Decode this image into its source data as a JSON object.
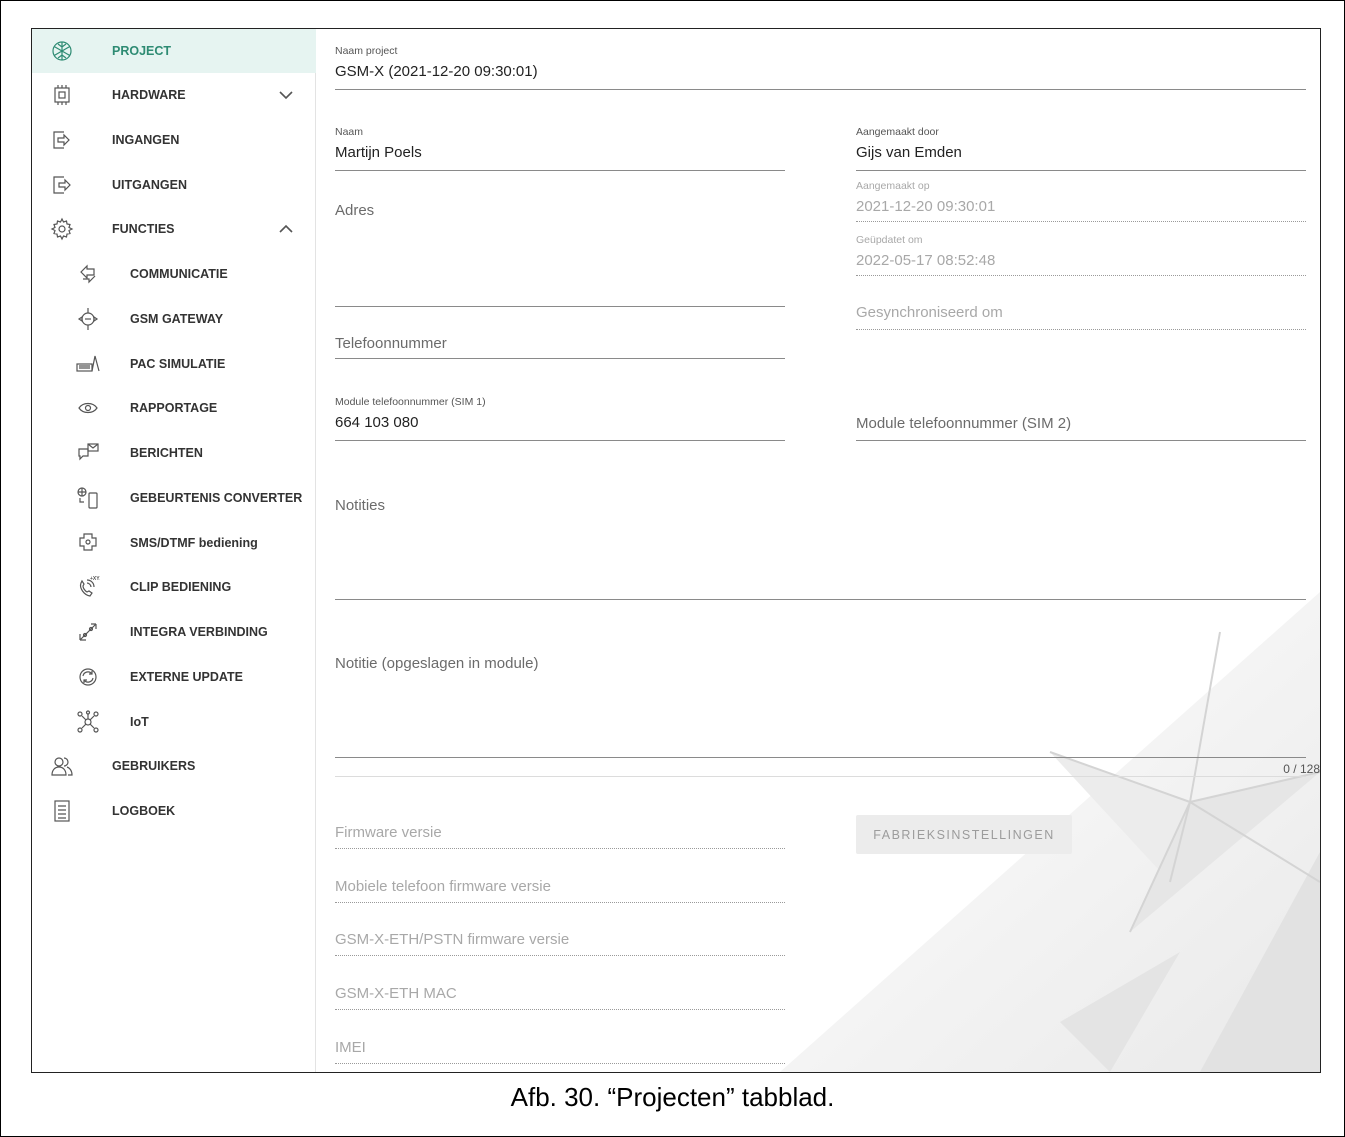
{
  "sidebar": {
    "items": [
      {
        "label": "PROJECT",
        "icon": "project-icon",
        "active": true
      },
      {
        "label": "HARDWARE",
        "icon": "hardware-icon",
        "expand": "chevron-down-icon"
      },
      {
        "label": "INGANGEN",
        "icon": "inputs-icon"
      },
      {
        "label": "UITGANGEN",
        "icon": "outputs-icon"
      },
      {
        "label": "FUNCTIES",
        "icon": "gear-icon",
        "expand": "chevron-up-icon"
      },
      {
        "label": "COMMUNICATIE",
        "icon": "communication-icon"
      },
      {
        "label": "GSM GATEWAY",
        "icon": "gsm-gateway-icon"
      },
      {
        "label": "PAC SIMULATIE",
        "icon": "pac-simulation-icon"
      },
      {
        "label": "RAPPORTAGE",
        "icon": "eye-icon"
      },
      {
        "label": "BERICHTEN",
        "icon": "messages-icon"
      },
      {
        "label": "GEBEURTENIS CONVERTER",
        "icon": "event-converter-icon"
      },
      {
        "label": "SMS/DTMF bediening",
        "icon": "sms-dtmf-icon"
      },
      {
        "label": "CLIP BEDIENING",
        "icon": "clip-control-icon"
      },
      {
        "label": "INTEGRA VERBINDING",
        "icon": "integra-connection-icon"
      },
      {
        "label": "EXTERNE UPDATE",
        "icon": "external-update-icon"
      },
      {
        "label": "IoT",
        "icon": "iot-icon"
      },
      {
        "label": "GEBRUIKERS",
        "icon": "users-icon"
      },
      {
        "label": "LOGBOEK",
        "icon": "logbook-icon"
      }
    ]
  },
  "form": {
    "project_name": {
      "label": "Naam project",
      "value": "GSM-X (2021-12-20 09:30:01)"
    },
    "name": {
      "label": "Naam",
      "value": "Martijn Poels"
    },
    "created_by": {
      "label": "Aangemaakt door",
      "value": "Gijs van Emden"
    },
    "address": {
      "placeholder": "Adres"
    },
    "created_on": {
      "label": "Aangemaakt op",
      "value": "2021-12-20 09:30:01"
    },
    "updated_on": {
      "label": "Geüpdatet om",
      "value": "2022-05-17 08:52:48"
    },
    "synchronized_on": {
      "placeholder": "Gesynchroniseerd om"
    },
    "phone": {
      "placeholder": "Telefoonnummer"
    },
    "module_phone_sim1": {
      "label": "Module telefoonnummer (SIM 1)",
      "value": "664 103 080"
    },
    "module_phone_sim2": {
      "placeholder": "Module telefoonnummer (SIM 2)"
    },
    "notes": {
      "placeholder": "Notities"
    },
    "module_note": {
      "placeholder": "Notitie (opgeslagen in module)",
      "counter": "0 / 128"
    },
    "firmware": {
      "placeholder": "Firmware versie"
    },
    "mobile_firmware": {
      "placeholder": "Mobiele telefoon firmware versie"
    },
    "eth_pstn_firmware": {
      "placeholder": "GSM-X-ETH/PSTN firmware versie"
    },
    "eth_mac": {
      "placeholder": "GSM-X-ETH MAC"
    },
    "imei": {
      "placeholder": "IMEI"
    },
    "factory_button": "FABRIEKSINSTELLINGEN"
  },
  "caption": "Afb. 30. “Projecten” tabblad."
}
